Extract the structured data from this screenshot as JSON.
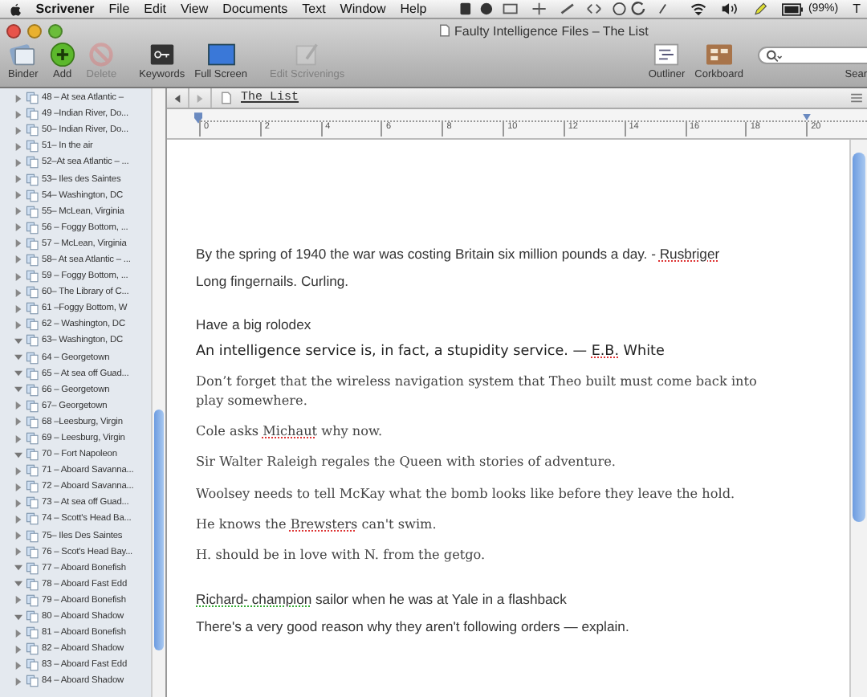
{
  "menu_bar": {
    "app": "Scrivener",
    "items": [
      "File",
      "Edit",
      "View",
      "Documents",
      "Text",
      "Window",
      "Help"
    ],
    "battery": "(99%)",
    "clock": "T"
  },
  "window": {
    "title": "Faulty Intelligence Files – The List"
  },
  "toolbar": {
    "left": [
      {
        "label": "Binder",
        "disabled": false
      },
      {
        "label": "Add",
        "disabled": false
      },
      {
        "label": "Delete",
        "disabled": true
      },
      {
        "label": "Keywords",
        "disabled": false
      },
      {
        "label": "Full Screen",
        "disabled": false
      },
      {
        "label": "Edit Scrivenings",
        "disabled": true
      }
    ],
    "right": [
      {
        "label": "Outliner",
        "disabled": false
      },
      {
        "label": "Corkboard",
        "disabled": false
      }
    ],
    "search_label": "Sear"
  },
  "binder": {
    "items": [
      {
        "label": "48 – At sea Atlantic –",
        "expanded": false
      },
      {
        "label": "49 –Indian River, Do...",
        "expanded": false
      },
      {
        "label": "50– Indian River, Do...",
        "expanded": false
      },
      {
        "label": "51– In the air",
        "expanded": false
      },
      {
        "label": "52–At sea Atlantic – ...",
        "expanded": false
      },
      {
        "label": "53– Iles des Saintes",
        "expanded": false
      },
      {
        "label": "54– Washington, DC",
        "expanded": false
      },
      {
        "label": "55– McLean, Virginia",
        "expanded": false
      },
      {
        "label": "56 – Foggy Bottom, ...",
        "expanded": false
      },
      {
        "label": "57 – McLean, Virginia",
        "expanded": false
      },
      {
        "label": "58– At sea Atlantic – ...",
        "expanded": false
      },
      {
        "label": "59 – Foggy Bottom, ...",
        "expanded": false
      },
      {
        "label": "60– The Library of C...",
        "expanded": false
      },
      {
        "label": "61 –Foggy Bottom, W",
        "expanded": false
      },
      {
        "label": "62 – Washington, DC",
        "expanded": false
      },
      {
        "label": "63– Washington, DC",
        "expanded": true
      },
      {
        "label": "64 – Georgetown",
        "expanded": true
      },
      {
        "label": "65 – At sea off Guad...",
        "expanded": true
      },
      {
        "label": "66 – Georgetown",
        "expanded": true
      },
      {
        "label": "67– Georgetown",
        "expanded": false
      },
      {
        "label": "68 –Leesburg, Virgin",
        "expanded": false
      },
      {
        "label": "69 – Leesburg, Virgin",
        "expanded": false
      },
      {
        "label": "70 – Fort Napoleon",
        "expanded": true
      },
      {
        "label": "71 – Aboard Savanna...",
        "expanded": false
      },
      {
        "label": "72 – Aboard Savanna...",
        "expanded": false
      },
      {
        "label": "73 – At sea off Guad...",
        "expanded": false
      },
      {
        "label": "74 – Scott's Head Ba...",
        "expanded": false
      },
      {
        "label": "75– Iles Des Saintes",
        "expanded": false
      },
      {
        "label": "76 – Scot's Head Bay...",
        "expanded": false
      },
      {
        "label": "77 – Aboard Bonefish",
        "expanded": true
      },
      {
        "label": "78 – Aboard Fast Edd",
        "expanded": true
      },
      {
        "label": "79 – Aboard Bonefish",
        "expanded": false
      },
      {
        "label": "80 – Aboard Shadow",
        "expanded": true
      },
      {
        "label": "81 – Aboard Bonefish",
        "expanded": false
      },
      {
        "label": "82 – Aboard Shadow",
        "expanded": false
      },
      {
        "label": "83 – Aboard Fast Edd",
        "expanded": false
      },
      {
        "label": "84 – Aboard Shadow",
        "expanded": false
      }
    ]
  },
  "editor": {
    "document_title": "The List",
    "ruler_labels": [
      "0",
      "2",
      "4",
      "6",
      "8",
      "10",
      "12",
      "14",
      "16",
      "18",
      "20"
    ],
    "paragraphs": [
      {
        "kind": "sans",
        "gap": false,
        "runs": [
          {
            "text": "By the spring of 1940 the war was costing Britain six million pounds a day. - "
          },
          {
            "text": "Rusbriger",
            "misspelled": true
          }
        ]
      },
      {
        "kind": "sans",
        "gap": false,
        "runs": [
          {
            "text": "Long fingernails.  Curling."
          }
        ]
      },
      {
        "kind": "sans",
        "gap": true,
        "runs": [
          {
            "text": "Have a big rolodex"
          }
        ]
      },
      {
        "kind": "large",
        "gap": false,
        "runs": [
          {
            "text": "An intelligence service is, in fact, a stupidity service. — "
          },
          {
            "text": "E.B.",
            "misspelled": true
          },
          {
            "text": " White"
          }
        ]
      },
      {
        "kind": "serif",
        "gap": false,
        "runs": [
          {
            "text": "Don’t forget that the wireless navigation system that Theo built must come back into play somewhere."
          }
        ]
      },
      {
        "kind": "serif",
        "gap": false,
        "runs": [
          {
            "text": "Cole asks "
          },
          {
            "text": "Michaut",
            "misspelled": true
          },
          {
            "text": " why now."
          }
        ]
      },
      {
        "kind": "serif",
        "gap": false,
        "runs": [
          {
            "text": "Sir Walter Raleigh regales the Queen with stories of adventure."
          }
        ]
      },
      {
        "kind": "serif",
        "gap": false,
        "runs": [
          {
            "text": "Woolsey needs to tell McKay what the bomb looks like before they leave the hold."
          }
        ]
      },
      {
        "kind": "serif",
        "gap": false,
        "runs": [
          {
            "text": "He knows the "
          },
          {
            "text": "Brewsters",
            "misspelled": true
          },
          {
            "text": " can't swim."
          }
        ]
      },
      {
        "kind": "serif",
        "gap": false,
        "runs": [
          {
            "text": "H. should be in love with N. from the getgo."
          }
        ]
      },
      {
        "kind": "sans",
        "gap": true,
        "runs": [
          {
            "text": "Richard-  champion",
            "grammar_error": true
          },
          {
            "text": " sailor when he was at Yale in a flashback"
          }
        ]
      },
      {
        "kind": "sans",
        "gap": false,
        "runs": [
          {
            "text": "There's a very good reason why they aren't following orders — explain."
          }
        ]
      }
    ]
  }
}
